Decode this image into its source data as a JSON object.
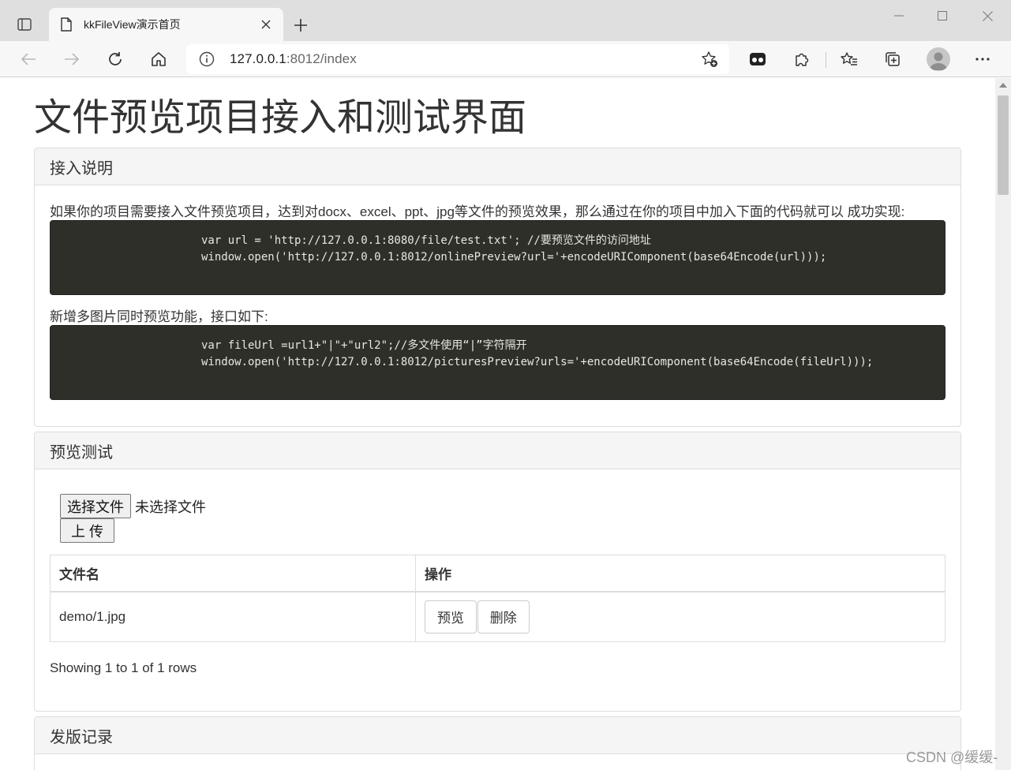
{
  "browser": {
    "tab_title": "kkFileView演示首页",
    "address_host": "127.0.0.1",
    "address_rest": ":8012/index"
  },
  "page": {
    "title": "文件预览项目接入和测试界面",
    "integration_panel": {
      "heading": "接入说明",
      "intro": "如果你的项目需要接入文件预览项目，达到对docx、excel、ppt、jpg等文件的预览效果，那么通过在你的项目中加入下面的代码就可以 成功实现:",
      "code1": [
        "var url = 'http://127.0.0.1:8080/file/test.txt'; //要预览文件的访问地址",
        "window.open('http://127.0.0.1:8012/onlinePreview?url='+encodeURIComponent(base64Encode(url)));"
      ],
      "multi_intro": "新增多图片同时预览功能，接口如下:",
      "code2": [
        "var fileUrl =url1+\"|\"+\"url2\";//多文件使用“|”字符隔开",
        "window.open('http://127.0.0.1:8012/picturesPreview?urls='+encodeURIComponent(base64Encode(fileUrl)));"
      ]
    },
    "test_panel": {
      "heading": "预览测试",
      "choose_file": "选择文件",
      "no_file": "未选择文件",
      "upload": "上 传",
      "columns": [
        "文件名",
        "操作"
      ],
      "rows": [
        {
          "filename": "demo/1.jpg",
          "preview": "预览",
          "delete": "删除"
        }
      ],
      "showing": "Showing 1 to 1 of 1 rows"
    },
    "release_panel": {
      "heading": "发版记录"
    }
  },
  "watermark": "CSDN @缓缓-"
}
